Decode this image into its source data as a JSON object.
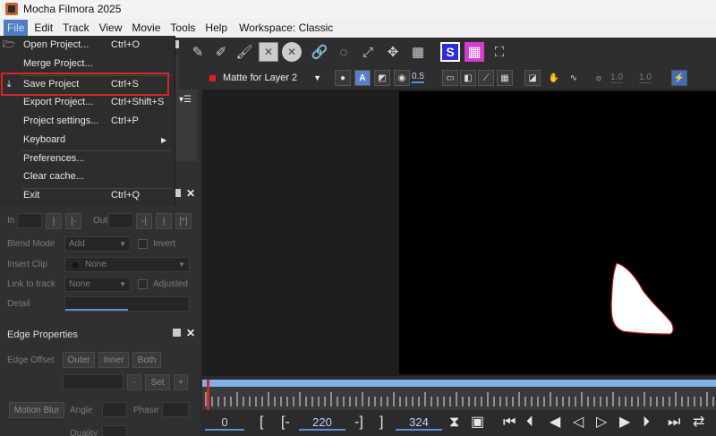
{
  "app": {
    "title": "Mocha Filmora 2025"
  },
  "menubar": {
    "items": [
      "File",
      "Edit",
      "Track",
      "View",
      "Movie",
      "Tools",
      "Help"
    ],
    "workspace": "Workspace: Classic"
  },
  "file_menu": {
    "items": [
      {
        "label": "Open Project...",
        "shortcut": "Ctrl+O",
        "icon": "folder-open-icon"
      },
      {
        "label": "Merge Project...",
        "shortcut": ""
      },
      {
        "label": "Save Project",
        "shortcut": "Ctrl+S",
        "icon": "download-icon"
      },
      {
        "label": "Export Project...",
        "shortcut": "Ctrl+Shift+S"
      },
      {
        "label": "Project settings...",
        "shortcut": "Ctrl+P"
      },
      {
        "label": "Keyboard",
        "shortcut": "",
        "submenu": true
      },
      {
        "label": "Preferences...",
        "shortcut": ""
      },
      {
        "label": "Clear cache...",
        "shortcut": ""
      },
      {
        "label": "Exit",
        "shortcut": "Ctrl+Q"
      }
    ]
  },
  "clip_panel": {
    "in_label": "In",
    "out_label": "Out",
    "blend_mode_label": "Blend Mode",
    "blend_mode_value": "Add",
    "invert_label": "Invert",
    "insert_clip_label": "Insert Clip",
    "insert_clip_value": "None",
    "link_to_track_label": "Link to track",
    "link_to_track_value": "None",
    "adjusted_label": "Adjusted",
    "detail_label": "Detail"
  },
  "edge_panel": {
    "title": "Edge Properties",
    "edge_offset_label": "Edge Offset",
    "outer_btn": "Outer",
    "inner_btn": "Inner",
    "both_btn": "Both",
    "set_btn": "Set",
    "motion_blur_btn": "Motion Blur",
    "angle_label": "Angle",
    "phase_label": "Phase",
    "quality_label": "Quality"
  },
  "viewer_toolbar": {
    "layer_selected": "Matte for Layer 2",
    "opacity_value": "0.5",
    "gamma_value": "1.0",
    "exposure_value": "1.0"
  },
  "transport": {
    "current_frame": "0",
    "in_frame": "220",
    "out_frame": "324"
  },
  "colors": {
    "accent_blue": "#7fb0e8",
    "highlight_red": "#d6262b",
    "layer_red": "#e02020",
    "s_button_blue": "#2d2de0",
    "grid_pink": "#d33bd3"
  }
}
